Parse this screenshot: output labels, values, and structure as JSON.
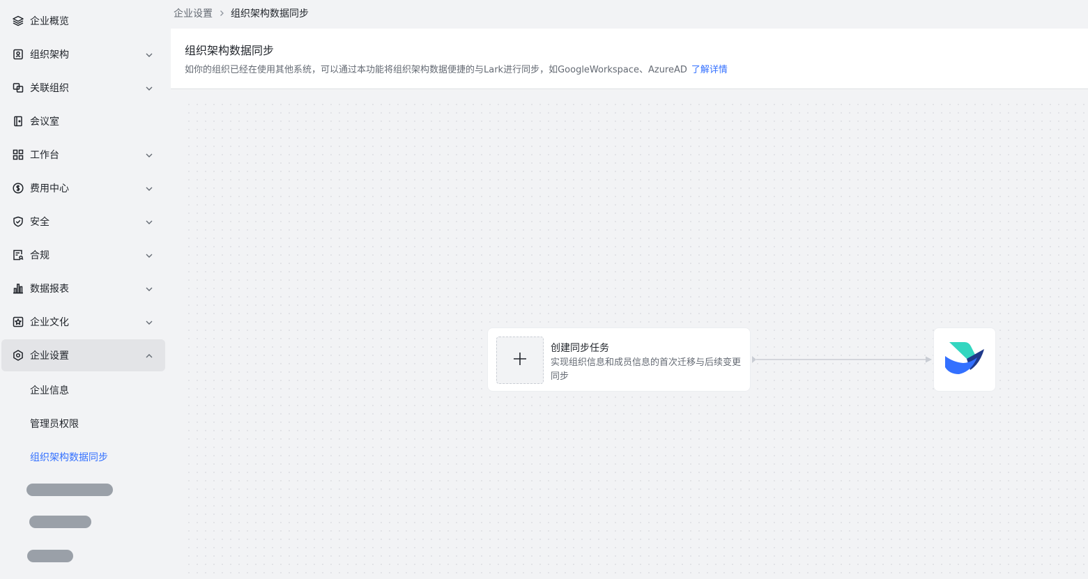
{
  "sidebar": {
    "items": [
      {
        "label": "企业概览",
        "icon": "layers-icon"
      },
      {
        "label": "组织架构",
        "icon": "org-card-icon"
      },
      {
        "label": "关联组织",
        "icon": "linked-squares-icon"
      },
      {
        "label": "会议室",
        "icon": "door-icon"
      },
      {
        "label": "工作台",
        "icon": "grid-icon"
      },
      {
        "label": "费用中心",
        "icon": "dollar-icon"
      },
      {
        "label": "安全",
        "icon": "shield-check-icon"
      },
      {
        "label": "合规",
        "icon": "compliance-doc-icon"
      },
      {
        "label": "数据报表",
        "icon": "bar-chart-icon"
      },
      {
        "label": "企业文化",
        "icon": "culture-star-icon"
      },
      {
        "label": "企业设置",
        "icon": "settings-hex-icon"
      }
    ],
    "sub_items": [
      {
        "label": "企业信息"
      },
      {
        "label": "管理员权限"
      },
      {
        "label": "组织架构数据同步"
      }
    ]
  },
  "breadcrumb": {
    "parent": "企业设置",
    "current": "组织架构数据同步"
  },
  "header": {
    "title": "组织架构数据同步",
    "description": "如你的组织已经在使用其他系统，可以通过本功能将组织架构数据便捷的与Lark进行同步，如GoogleWorkspace、AzureAD",
    "link": "了解详情"
  },
  "canvas": {
    "task_title": "创建同步任务",
    "task_desc": "实现组织信息和成员信息的首次迁移与后续变更同步",
    "target_logo": "lark-logo-icon"
  },
  "colors": {
    "accent": "#3370ff",
    "sidebar_bg": "#f2f3f5",
    "active_bg": "#e3e4e7",
    "text_primary": "#1f2329",
    "text_secondary": "#646a73"
  }
}
